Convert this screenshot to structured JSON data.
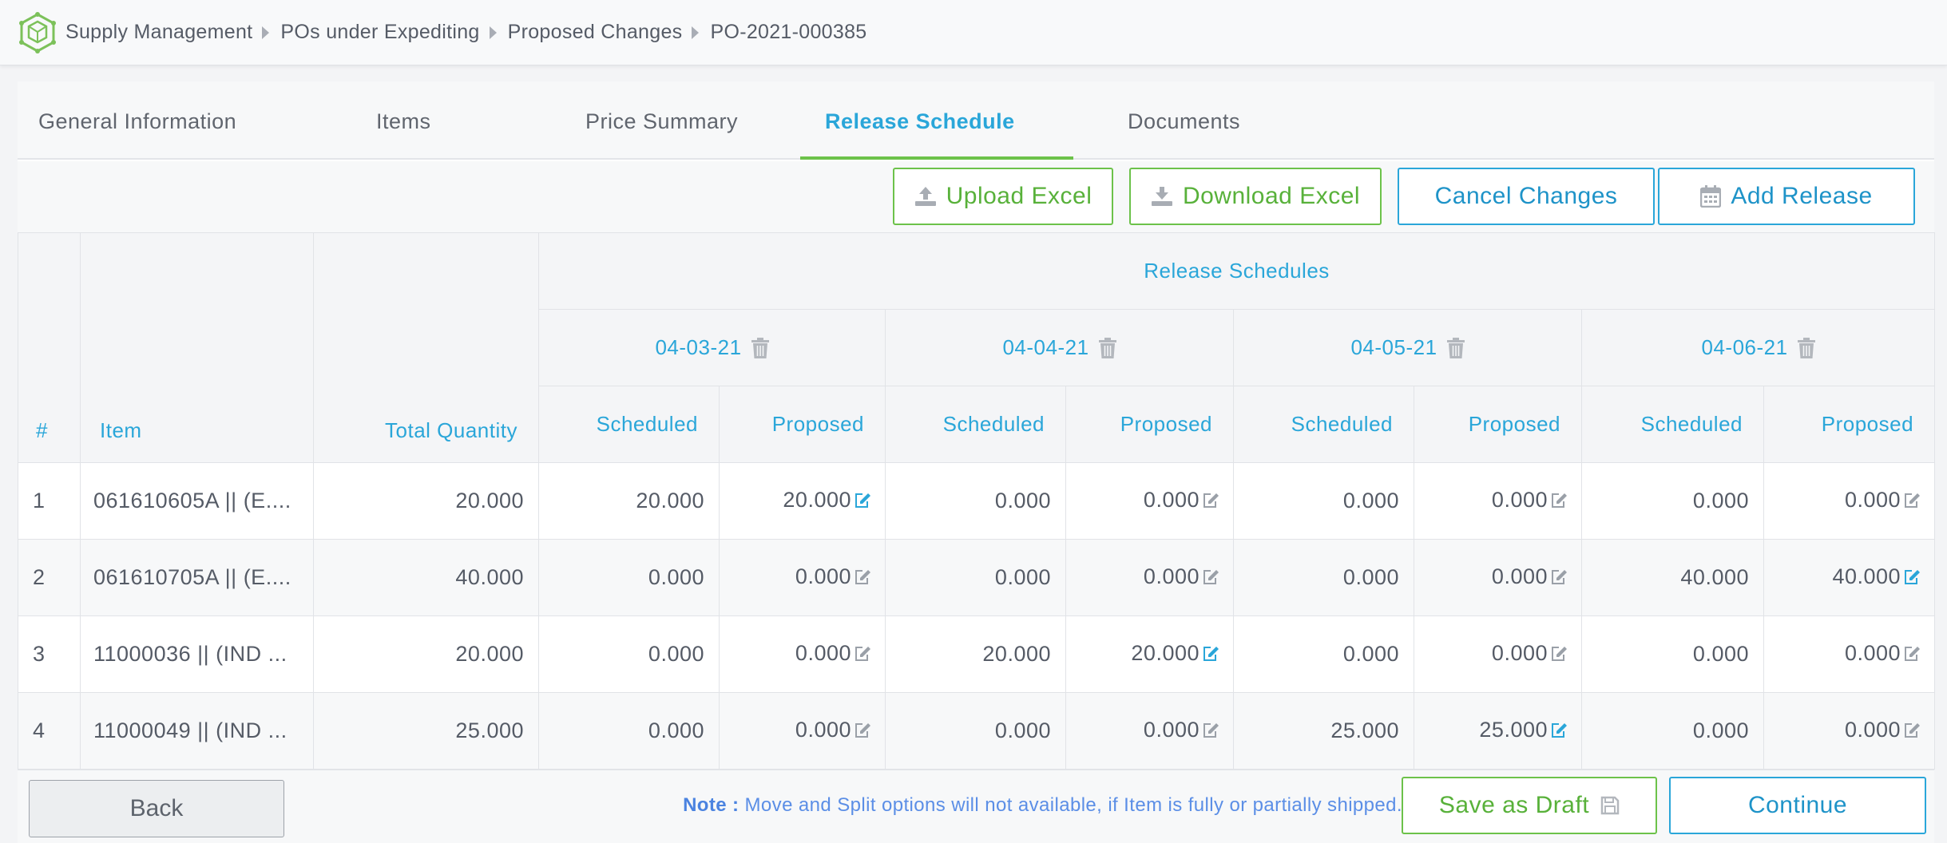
{
  "breadcrumb": [
    "Supply Management",
    "POs under Expediting",
    "Proposed Changes",
    "PO-2021-000385"
  ],
  "tabs": [
    "General Information",
    "Items",
    "Price Summary",
    "Release Schedule",
    "Documents"
  ],
  "active_tab": "Release Schedule",
  "toolbar": {
    "upload": "Upload Excel",
    "download": "Download Excel",
    "cancel": "Cancel Changes",
    "add_release": "Add Release"
  },
  "table": {
    "headers": {
      "num": "#",
      "item": "Item",
      "total_qty": "Total Quantity",
      "group": "Release Schedules",
      "scheduled": "Scheduled",
      "proposed": "Proposed"
    },
    "dates": [
      "04-03-21",
      "04-04-21",
      "04-05-21",
      "04-06-21"
    ],
    "rows": [
      {
        "num": "1",
        "item": "061610605A || (E....",
        "total": "20.000",
        "vals": [
          "20.000",
          "20.000",
          "0.000",
          "0.000",
          "0.000",
          "0.000",
          "0.000",
          "0.000"
        ]
      },
      {
        "num": "2",
        "item": "061610705A || (E....",
        "total": "40.000",
        "vals": [
          "0.000",
          "0.000",
          "0.000",
          "0.000",
          "0.000",
          "0.000",
          "40.000",
          "40.000"
        ]
      },
      {
        "num": "3",
        "item": "11000036 || (IND ...",
        "total": "20.000",
        "vals": [
          "0.000",
          "0.000",
          "20.000",
          "20.000",
          "0.000",
          "0.000",
          "0.000",
          "0.000"
        ]
      },
      {
        "num": "4",
        "item": "11000049 || (IND ...",
        "total": "25.000",
        "vals": [
          "0.000",
          "0.000",
          "0.000",
          "0.000",
          "25.000",
          "25.000",
          "0.000",
          "0.000"
        ]
      }
    ]
  },
  "footer": {
    "back": "Back",
    "note_label": "Note :",
    "note_text": " Move and Split options will not available, if Item is fully or partially shipped.",
    "save_draft": "Save as Draft",
    "continue": "Continue"
  },
  "colors": {
    "accent_blue": "#2aa6d9",
    "accent_green": "#6cc24a",
    "note_blue": "#5b8ee6"
  }
}
